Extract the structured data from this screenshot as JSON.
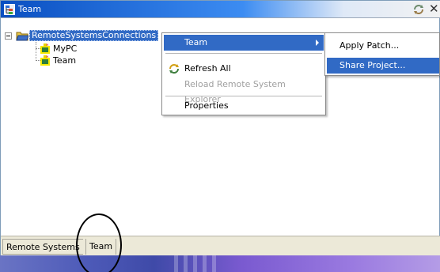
{
  "view": {
    "title": "Team",
    "icons": {
      "title": "tree-view-icon",
      "sync": "sync-icon",
      "close": "close-icon"
    },
    "close_glyph": "✕"
  },
  "tree": {
    "root_label": "RemoteSystemsConnections",
    "children": [
      {
        "label": "MyPC",
        "icon": "connection-icon"
      },
      {
        "label": "Team",
        "icon": "connection-icon"
      }
    ]
  },
  "context_menu": {
    "items": [
      {
        "label": "Team",
        "state": "selected",
        "has_submenu": true
      },
      {
        "label": "Refresh All",
        "state": "enabled",
        "icon": "refresh-icon"
      },
      {
        "label": "Reload Remote System Explorer",
        "state": "disabled"
      },
      {
        "label": "Properties",
        "state": "enabled"
      }
    ]
  },
  "submenu": {
    "items": [
      {
        "label": "Apply Patch...",
        "state": "enabled"
      },
      {
        "label": "Share Project...",
        "state": "selected"
      }
    ]
  },
  "tabs": [
    {
      "label": "Remote Systems",
      "active": false
    },
    {
      "label": "Team",
      "active": true
    }
  ],
  "colors": {
    "selection": "#316ac5",
    "title_gradient_start": "#0a4fc1",
    "status_bg": "#ece9d8",
    "disabled_text": "#a0a0a0"
  }
}
